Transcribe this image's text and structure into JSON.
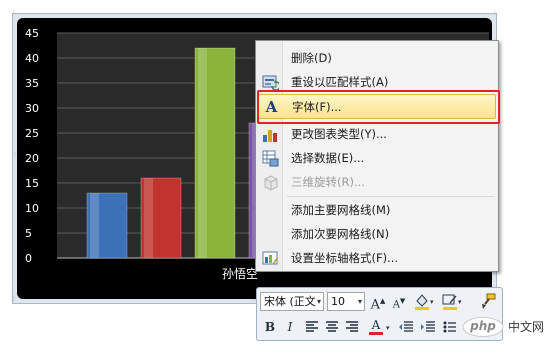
{
  "chart_data": {
    "type": "bar",
    "categories": [
      "孙悟空"
    ],
    "series": [
      {
        "values": [
          13
        ],
        "color": "#3c71b8"
      },
      {
        "values": [
          16
        ],
        "color": "#c0332e"
      },
      {
        "values": [
          42
        ],
        "color": "#8cb43c"
      },
      {
        "values": [
          27
        ],
        "color": "#7a53a6"
      }
    ],
    "ylim": [
      0,
      45
    ],
    "yticks": [
      "45",
      "40",
      "35",
      "30",
      "25",
      "20",
      "15",
      "10",
      "5",
      "0"
    ],
    "grid": true,
    "colors": {
      "background": "#000000",
      "plot_area": "#2a2a2a",
      "text": "#ffffff"
    }
  },
  "context_menu": {
    "items": [
      {
        "label": "删除(D)",
        "icon": "none",
        "enabled": true
      },
      {
        "label": "重设以匹配样式(A)",
        "icon": "reset-style-icon",
        "enabled": true
      },
      {
        "label": "字体(F)...",
        "icon": "font-letter-a-icon",
        "enabled": true,
        "highlighted": true
      },
      {
        "label": "更改图表类型(Y)...",
        "icon": "chart-type-icon",
        "enabled": true
      },
      {
        "label": "选择数据(E)...",
        "icon": "select-data-icon",
        "enabled": true
      },
      {
        "label": "三维旋转(R)...",
        "icon": "rotate-3d-icon",
        "enabled": false
      },
      {
        "label": "添加主要网格线(M)",
        "icon": "none",
        "enabled": true
      },
      {
        "label": "添加次要网格线(N)",
        "icon": "none",
        "enabled": true
      },
      {
        "label": "设置坐标轴格式(F)...",
        "icon": "format-axis-icon",
        "enabled": true
      }
    ],
    "colors": {
      "highlight_outline": "#e02424"
    }
  },
  "mini_toolbar": {
    "font_name": "宋体 (正文",
    "font_size": "10",
    "grow_font": "A",
    "shrink_font": "A",
    "bold": "B",
    "italic": "I",
    "font_color_letter": "A"
  },
  "watermark": {
    "logo_text": "php",
    "text": "中文网"
  }
}
